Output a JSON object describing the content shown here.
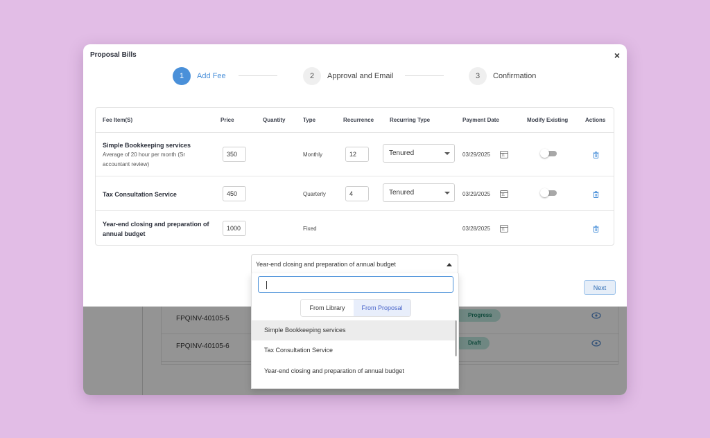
{
  "dialog": {
    "title": "Proposal Bills",
    "close": "×"
  },
  "steps": [
    {
      "num": "1",
      "label": "Add Fee",
      "active": true
    },
    {
      "num": "2",
      "label": "Approval and Email",
      "active": false
    },
    {
      "num": "3",
      "label": "Confirmation",
      "active": false
    }
  ],
  "table": {
    "headers": [
      "Fee Item(S)",
      "Price",
      "Quantity",
      "Type",
      "Recurrence",
      "Recurring Type",
      "Payment Date",
      "Modify Existing",
      "Actions"
    ],
    "rows": [
      {
        "name": "Simple Bookkeeping services",
        "desc": "Average of 20 hour per month (Sr accountant review)",
        "price": "350",
        "type": "Monthly",
        "recurrence": "12",
        "recurring_type": "Tenured",
        "date": "03/29/2025"
      },
      {
        "name": "Tax Consultation Service",
        "desc": "",
        "price": "450",
        "type": "Quarterly",
        "recurrence": "4",
        "recurring_type": "Tenured",
        "date": "03/29/2025"
      },
      {
        "name": "Year-end closing and preparation of annual budget",
        "desc": "",
        "price": "1000",
        "type": "Fixed",
        "recurrence": "",
        "recurring_type": "",
        "date": "03/28/2025"
      }
    ]
  },
  "fee_select": {
    "value": "Year-end closing and preparation of annual budget"
  },
  "next_label": "Next",
  "dropdown": {
    "tabs": [
      "From Library",
      "From Proposal"
    ],
    "active_tab": "From Proposal",
    "items": [
      "Simple Bookkeeping services",
      "Tax Consultation Service",
      "Year-end closing and preparation of annual budget"
    ]
  },
  "background": {
    "rows": [
      {
        "invoice": "FPQINV-40105-5",
        "status": "Progress"
      },
      {
        "invoice": "FPQINV-40105-6",
        "status": "Draft"
      }
    ]
  },
  "colors": {
    "accent": "#4a90d9",
    "page_bg": "#e2bde6",
    "status_badge_bg": "#bfe9e0"
  }
}
